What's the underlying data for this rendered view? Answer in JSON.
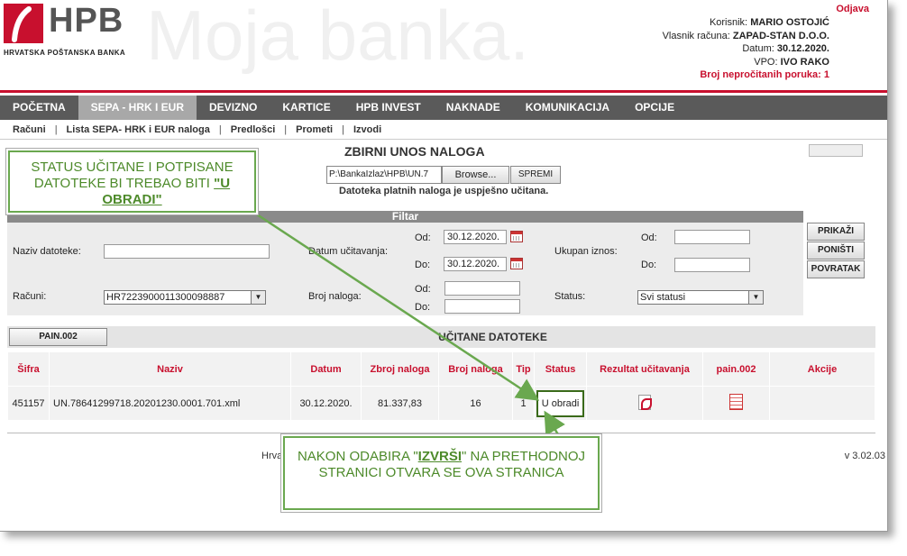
{
  "brand": {
    "logo": "HPB",
    "subtitle": "HRVATSKA POŠTANSKA BANKA",
    "watermark": "Moja banka."
  },
  "header": {
    "logout": "Odjava",
    "user_label": "Korisnik:",
    "user_value": "MARIO OSTOJIĆ",
    "owner_label": "Vlasnik računa:",
    "owner_value": "ZAPAD-STAN D.O.O.",
    "date_label": "Datum:",
    "date_value": "30.12.2020.",
    "vpo_label": "VPO:",
    "vpo_value": "IVO RAKO",
    "unread": "Broj nepročitanih poruka: 1"
  },
  "nav": [
    "POČETNA",
    "SEPA - HRK I EUR",
    "DEVIZNO",
    "KARTICE",
    "HPB INVEST",
    "NAKNADE",
    "KOMUNIKACIJA",
    "OPCIJE"
  ],
  "subnav": [
    "Računi",
    "Lista SEPA- HRK i EUR naloga",
    "Predlošci",
    "Prometi",
    "Izvodi"
  ],
  "upload": {
    "title": "ZBIRNI UNOS NALOGA",
    "file_path": "P:\\BankaIzlaz\\HPB\\UN.7",
    "browse": "Browse...",
    "save": "SPREMI",
    "message": "Datoteka platnih naloga je uspješno učitana."
  },
  "filter": {
    "title": "Filtar",
    "file_name_label": "Naziv datoteke:",
    "upload_date_label": "Datum učitavanja:",
    "from_label": "Od:",
    "to_label": "Do:",
    "date_from": "30.12.2020.",
    "date_to": "30.12.2020.",
    "total_label": "Ukupan iznos:",
    "accounts_label": "Računi:",
    "account_value": "HR7223900011300098887",
    "orders_label": "Broj naloga:",
    "status_label": "Status:",
    "status_value": "Svi statusi",
    "btn_show": "PRIKAŽI",
    "btn_reset": "PONIŠTI",
    "btn_back": "POVRATAK"
  },
  "files": {
    "tab": "PAIN.002",
    "title": "UČITANE DATOTEKE",
    "columns": [
      "Šifra",
      "Naziv",
      "Datum",
      "Zbroj naloga",
      "Broj naloga",
      "Tip",
      "Status",
      "Rezultat učitavanja",
      "pain.002",
      "Akcije"
    ],
    "rows": [
      {
        "id": "451157",
        "name": "UN.78641299718.20201230.0001.701.xml",
        "date": "30.12.2020.",
        "sum": "81.337,83",
        "count": "16",
        "type": "1",
        "status": "U obradi"
      }
    ]
  },
  "footer": {
    "left": "Hrva",
    "version": "v 3.02.03"
  },
  "callouts": {
    "top_text": "STATUS UČITANE I POTPISANE DATOTEKE BI TREBAO BITI",
    "top_highlight": "\"U OBRADI\"",
    "bottom_text_a": "NAKON ODABIRA \"",
    "bottom_highlight": "IZVRŠI",
    "bottom_text_b": "\" NA PRETHODNOJ STRANICI OTVARA SE OVA STRANICA"
  },
  "colors": {
    "brand_red": "#c8102e",
    "nav_bg": "#5a5a5a",
    "callout_green": "#6aa84f"
  }
}
